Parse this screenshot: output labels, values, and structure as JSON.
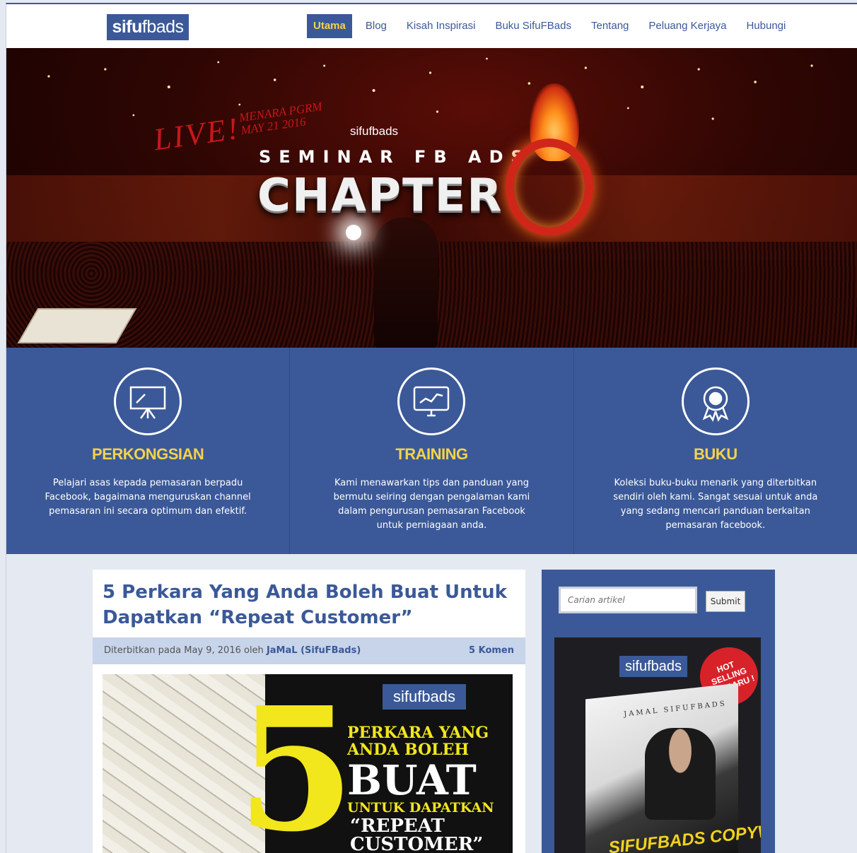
{
  "nav": {
    "logo_bold": "sifu",
    "logo_light": "fbads",
    "items": [
      {
        "label": "Utama",
        "active": true
      },
      {
        "label": "Blog"
      },
      {
        "label": "Kisah Inspirasi"
      },
      {
        "label": "Buku SifuFBads"
      },
      {
        "label": "Tentang"
      },
      {
        "label": "Peluang Kerjaya"
      },
      {
        "label": "Hubungi"
      }
    ]
  },
  "hero": {
    "live": "LIVE!",
    "venue_line1": "MENARA PGRM",
    "venue_line2": "MAY 21 2016",
    "brand": "sifufbads",
    "seminar": "SEMINAR FB ADS",
    "chapter": "CHAPTER"
  },
  "features": [
    {
      "icon": "presentation-board-icon",
      "title": "PERKONGSIAN",
      "text": "Pelajari asas kepada pemasaran berpadu Facebook, bagaimana menguruskan channel pemasaran ini secara optimum dan efektif."
    },
    {
      "icon": "monitor-chart-icon",
      "title": "TRAINING",
      "text": "Kami menawarkan tips dan panduan yang bermutu seiring dengan pengalaman kami dalam pengurusan pemasaran Facebook untuk perniagaan anda."
    },
    {
      "icon": "award-badge-icon",
      "title": "BUKU",
      "text": "Koleksi buku-buku menarik yang diterbitkan sendiri oleh kami. Sangat sesuai untuk anda yang sedang mencari panduan berkaitan pemasaran facebook."
    }
  ],
  "article": {
    "title": "5 Perkara Yang Anda Boleh Buat Untuk Dapatkan “Repeat Customer”",
    "meta_prefix": "Diterbitkan pada May 9, 2016 oleh",
    "author": "JaMaL (SifuFBads)",
    "comments": "5 Komen",
    "image": {
      "brand": "sifufbads",
      "number": "5",
      "line1": "PERKARA YANG",
      "line2": "ANDA BOLEH",
      "line3": "BUAT",
      "line4": "UNTUK DAPATKAN",
      "line5": "“REPEAT",
      "line6": "CUSTOMER”"
    }
  },
  "sidebar": {
    "search_placeholder": "Carian artikel",
    "submit_label": "Submit",
    "book": {
      "brand": "sifufbads",
      "badge_line1": "HOT",
      "badge_line2": "SELLING",
      "badge_line3": "TERBARU !",
      "author": "JAMAL SIFUFBADS",
      "title": "SIFUFBADS COPYWRITING"
    }
  },
  "colors": {
    "brand_blue": "#3b5998",
    "accent_yellow": "#f4d24b"
  }
}
